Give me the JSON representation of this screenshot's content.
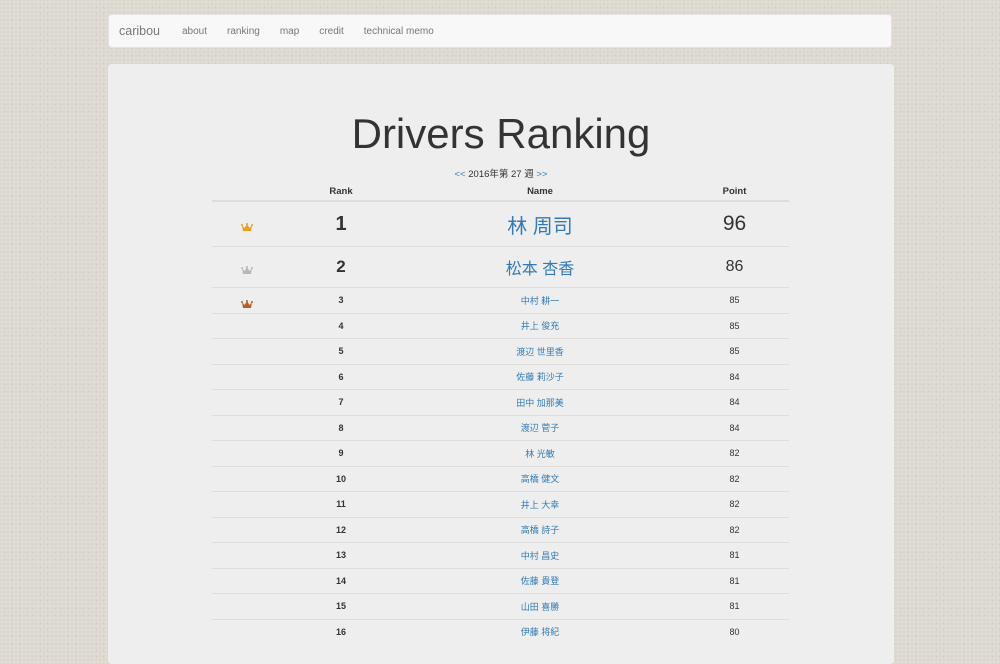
{
  "nav": {
    "brand": "caribou",
    "items": [
      "about",
      "ranking",
      "map",
      "credit",
      "technical memo"
    ]
  },
  "page": {
    "title": "Drivers Ranking",
    "week_prev": "<<",
    "week_label": "2016年第 27 週",
    "week_next": ">>"
  },
  "table": {
    "headers": {
      "rank": "Rank",
      "name": "Name",
      "point": "Point"
    },
    "rows": [
      {
        "rank": "1",
        "name": "林 周司",
        "point": "96",
        "crown": "gold-crown-icon"
      },
      {
        "rank": "2",
        "name": "松本 杏香",
        "point": "86",
        "crown": "silver-crown-icon"
      },
      {
        "rank": "3",
        "name": "中村 耕一",
        "point": "85",
        "crown": "bronze-crown-icon"
      },
      {
        "rank": "4",
        "name": "井上 俊充",
        "point": "85"
      },
      {
        "rank": "5",
        "name": "渡辺 世里香",
        "point": "85"
      },
      {
        "rank": "6",
        "name": "佐藤 莉沙子",
        "point": "84"
      },
      {
        "rank": "7",
        "name": "田中 加那美",
        "point": "84"
      },
      {
        "rank": "8",
        "name": "渡辺 菅子",
        "point": "84"
      },
      {
        "rank": "9",
        "name": "林 光敏",
        "point": "82"
      },
      {
        "rank": "10",
        "name": "高橋 健文",
        "point": "82"
      },
      {
        "rank": "11",
        "name": "井上 大幸",
        "point": "82"
      },
      {
        "rank": "12",
        "name": "高橋 詩子",
        "point": "82"
      },
      {
        "rank": "13",
        "name": "中村 昌史",
        "point": "81"
      },
      {
        "rank": "14",
        "name": "佐藤 貴登",
        "point": "81"
      },
      {
        "rank": "15",
        "name": "山田 喜勝",
        "point": "81"
      },
      {
        "rank": "16",
        "name": "伊藤 将紀",
        "point": "80"
      }
    ]
  },
  "colors": {
    "link": "#337ab7",
    "gold": "#e8a020",
    "silver": "#b8b8b8",
    "bronze": "#b5602a"
  }
}
